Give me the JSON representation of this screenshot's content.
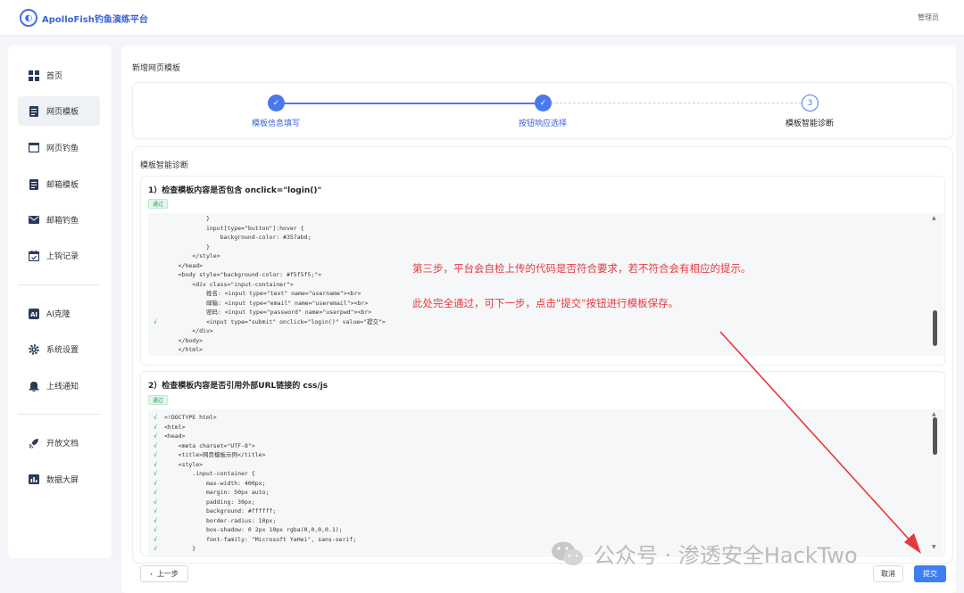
{
  "app": {
    "brand": "ApolloFish钓鱼演练平台",
    "user": "管理员"
  },
  "sidebar": {
    "items": [
      {
        "label": "首页",
        "icon": "grid-icon"
      },
      {
        "label": "网页模板",
        "icon": "document-icon",
        "active": true
      },
      {
        "label": "网页钓鱼",
        "icon": "window-icon"
      },
      {
        "label": "邮箱模板",
        "icon": "document-icon"
      },
      {
        "label": "邮箱钓鱼",
        "icon": "mail-icon"
      },
      {
        "label": "上钩记录",
        "icon": "calendar-icon"
      },
      {
        "label": "AI克隆",
        "icon": "ai-icon"
      },
      {
        "label": "系统设置",
        "icon": "gear-icon"
      },
      {
        "label": "上线通知",
        "icon": "bell-icon"
      },
      {
        "label": "开放文档",
        "icon": "rocket-icon"
      },
      {
        "label": "数据大屏",
        "icon": "chart-icon"
      }
    ]
  },
  "page": {
    "title": "新增网页模板"
  },
  "steps": [
    {
      "label": "模板信息填写",
      "status": "done"
    },
    {
      "label": "按钮响应选择",
      "status": "done"
    },
    {
      "label": "模板智能诊断",
      "status": "current",
      "number": "3"
    }
  ],
  "diagnosis": {
    "title": "模板智能诊断",
    "checks": [
      {
        "title": "1）检查模板内容是否包含 onclick=\"login()\"",
        "badge": "通过",
        "lines": [
          {
            "mark": "",
            "text": "            }"
          },
          {
            "mark": "",
            "text": "            input[type=\"button\"]:hover {"
          },
          {
            "mark": "",
            "text": "                background-color: #357abd;"
          },
          {
            "mark": "",
            "text": "            }"
          },
          {
            "mark": "",
            "text": "        </style>"
          },
          {
            "mark": "",
            "text": "    </head>"
          },
          {
            "mark": "",
            "text": "    <body style=\"background-color: #f5f5f5;\">"
          },
          {
            "mark": "",
            "text": "        <div class=\"input-container\">"
          },
          {
            "mark": "",
            "text": "            姓名: <input type=\"text\" name=\"username\"><br>"
          },
          {
            "mark": "",
            "text": "            邮箱: <input type=\"email\" name=\"useremail\"><br>"
          },
          {
            "mark": "",
            "text": "            密码: <input type=\"password\" name=\"userpwd\"><br>"
          },
          {
            "mark": "√",
            "text": "            <input type=\"submit\" onclick=\"login()\" value=\"提交\">"
          },
          {
            "mark": "",
            "text": "        </div>"
          },
          {
            "mark": "",
            "text": "    </body>"
          },
          {
            "mark": "",
            "text": "    </html>"
          }
        ]
      },
      {
        "title": "2）检查模板内容是否引用外部URL链接的 css/js",
        "badge": "通过",
        "lines": [
          {
            "mark": "√",
            "text": "<!DOCTYPE html>"
          },
          {
            "mark": "√",
            "text": "<html>"
          },
          {
            "mark": "√",
            "text": "<head>"
          },
          {
            "mark": "√",
            "text": "    <meta charset=\"UTF-8\">"
          },
          {
            "mark": "√",
            "text": "    <title>网页模板示例</title>"
          },
          {
            "mark": "√",
            "text": "    <style>"
          },
          {
            "mark": "√",
            "text": "        .input-container {"
          },
          {
            "mark": "√",
            "text": "            max-width: 400px;"
          },
          {
            "mark": "√",
            "text": "            margin: 50px auto;"
          },
          {
            "mark": "√",
            "text": "            padding: 30px;"
          },
          {
            "mark": "√",
            "text": "            background: #ffffff;"
          },
          {
            "mark": "√",
            "text": "            border-radius: 10px;"
          },
          {
            "mark": "√",
            "text": "            box-shadow: 0 2px 10px rgba(0,0,0,0.1);"
          },
          {
            "mark": "√",
            "text": "            font-family: \"Microsoft YaHei\", sans-serif;"
          },
          {
            "mark": "√",
            "text": "        }"
          }
        ]
      }
    ]
  },
  "annotation": {
    "line1": "第三步，平台会自检上传的代码是否符合要求，若不符合会有相应的提示。",
    "line2": "此处完全通过，可下一步，点击\"提交\"按钮进行模板保存。",
    "color": "#e6393d"
  },
  "buttons": {
    "prev": "上一步",
    "cancel": "取消",
    "submit": "提交"
  },
  "watermark": "公众号 · 渗透安全HackTwo"
}
